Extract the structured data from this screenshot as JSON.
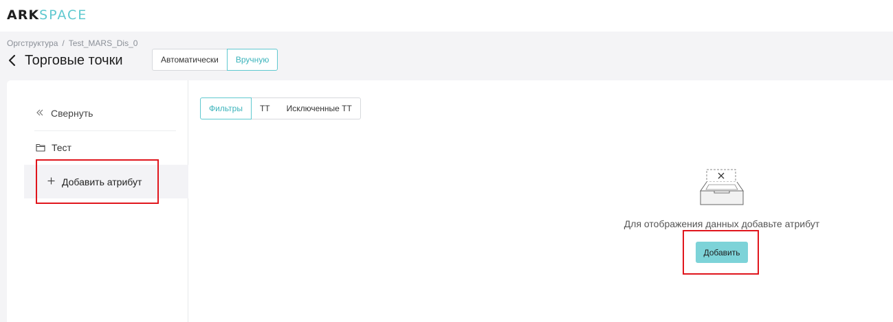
{
  "header": {
    "logo_ark": "ARK",
    "logo_space": "SPACE"
  },
  "breadcrumb": {
    "items": [
      "Оргструктура",
      "Test_MARS_Dis_0"
    ],
    "separator": "/"
  },
  "page": {
    "title": "Торговые точки",
    "back_icon": "chevron-left-icon"
  },
  "mode_toggle": {
    "options": [
      "Автоматически",
      "Вручную"
    ],
    "selected": "Вручную"
  },
  "sidebar": {
    "collapse_label": "Свернуть",
    "collapse_icon": "double-chevron-left-icon",
    "folder_label": "Тест",
    "folder_icon": "folder-icon",
    "add_attribute_label": "Добавить атрибут",
    "add_attribute_icon": "plus-icon"
  },
  "tabs": {
    "items": [
      "Фильтры",
      "ТТ",
      "Исключенные ТТ"
    ],
    "selected": "Фильтры"
  },
  "empty_state": {
    "icon": "empty-box-icon",
    "message": "Для отображения данных добавьте атрибут",
    "button_label": "Добавить"
  },
  "colors": {
    "accent": "#5ec8cf",
    "button_bg": "#7dd3d8",
    "highlight_border": "#e0141b",
    "page_bg": "#f4f4f6"
  }
}
